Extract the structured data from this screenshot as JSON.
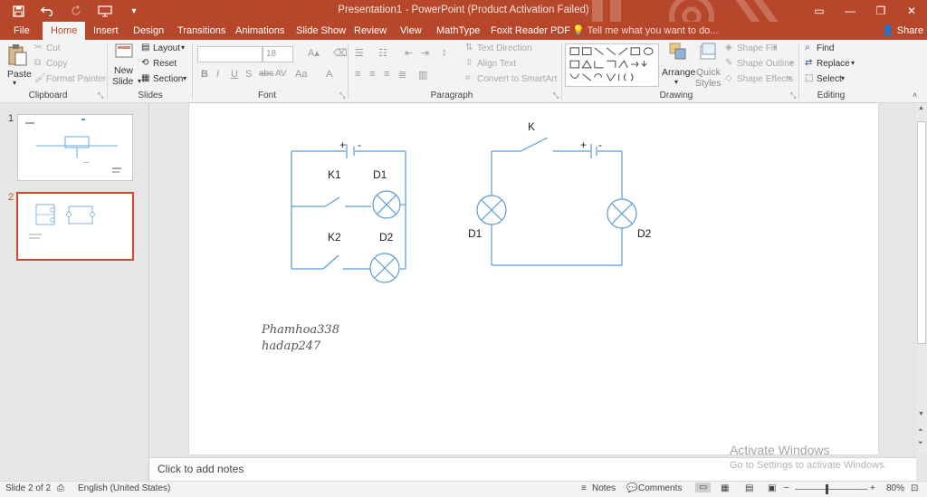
{
  "window": {
    "title": "Presentation1 - PowerPoint (Product Activation Failed)",
    "save_icon": "save-icon",
    "undo_icon": "undo-icon",
    "redo_icon": "redo-icon",
    "present_icon": "start-from-beginning-icon",
    "customize_icon": "customize-qat-icon"
  },
  "tabs": [
    "File",
    "Home",
    "Insert",
    "Design",
    "Transitions",
    "Animations",
    "Slide Show",
    "Review",
    "View",
    "MathType",
    "Foxit Reader PDF"
  ],
  "active_tab": "Home",
  "tell_me": "Tell me what you want to do...",
  "share": "Share",
  "ribbon": {
    "clipboard": {
      "label": "Clipboard",
      "paste": "Paste",
      "cut": "Cut",
      "copy": "Copy",
      "format_painter": "Format Painter"
    },
    "slides": {
      "label": "Slides",
      "new_slide": "New",
      "new_slide2": "Slide",
      "layout": "Layout",
      "reset": "Reset",
      "section": "Section"
    },
    "font": {
      "label": "Font",
      "size": "18",
      "bold": "B",
      "italic": "I",
      "underline": "U",
      "strike": "S",
      "shadow": "abc",
      "spacing": "AV",
      "case": "Aa",
      "color": "A"
    },
    "paragraph": {
      "label": "Paragraph",
      "text_direction": "Text Direction",
      "align_text": "Align Text",
      "smartart": "Convert to SmartArt"
    },
    "drawing": {
      "label": "Drawing",
      "arrange": "Arrange",
      "quick": "Quick",
      "styles": "Styles",
      "shape_fill": "Shape Fill",
      "shape_outline": "Shape Outline",
      "shape_effects": "Shape Effects"
    },
    "editing": {
      "label": "Editing",
      "find": "Find",
      "replace": "Replace",
      "select": "Select"
    }
  },
  "thumbnails": [
    {
      "number": "1",
      "selected": false
    },
    {
      "number": "2",
      "selected": true
    }
  ],
  "slide": {
    "circuit1": {
      "plus": "+",
      "minus": "-",
      "k1": "K1",
      "d1": "D1",
      "k2": "K2",
      "d2": "D2"
    },
    "circuit2": {
      "k": "K",
      "plus": "+",
      "minus": "-",
      "d1": "D1",
      "d2": "D2"
    },
    "handwriting": [
      "Phamhoa338",
      "hadap247"
    ]
  },
  "notes_placeholder": "Click to add notes",
  "watermark": {
    "line1": "Activate Windows",
    "line2": "Go to Settings to activate Windows."
  },
  "status": {
    "slide_counter": "Slide 2 of 2",
    "language": "English (United States)",
    "notes": "Notes",
    "comments": "Comments",
    "zoom": "80%"
  }
}
